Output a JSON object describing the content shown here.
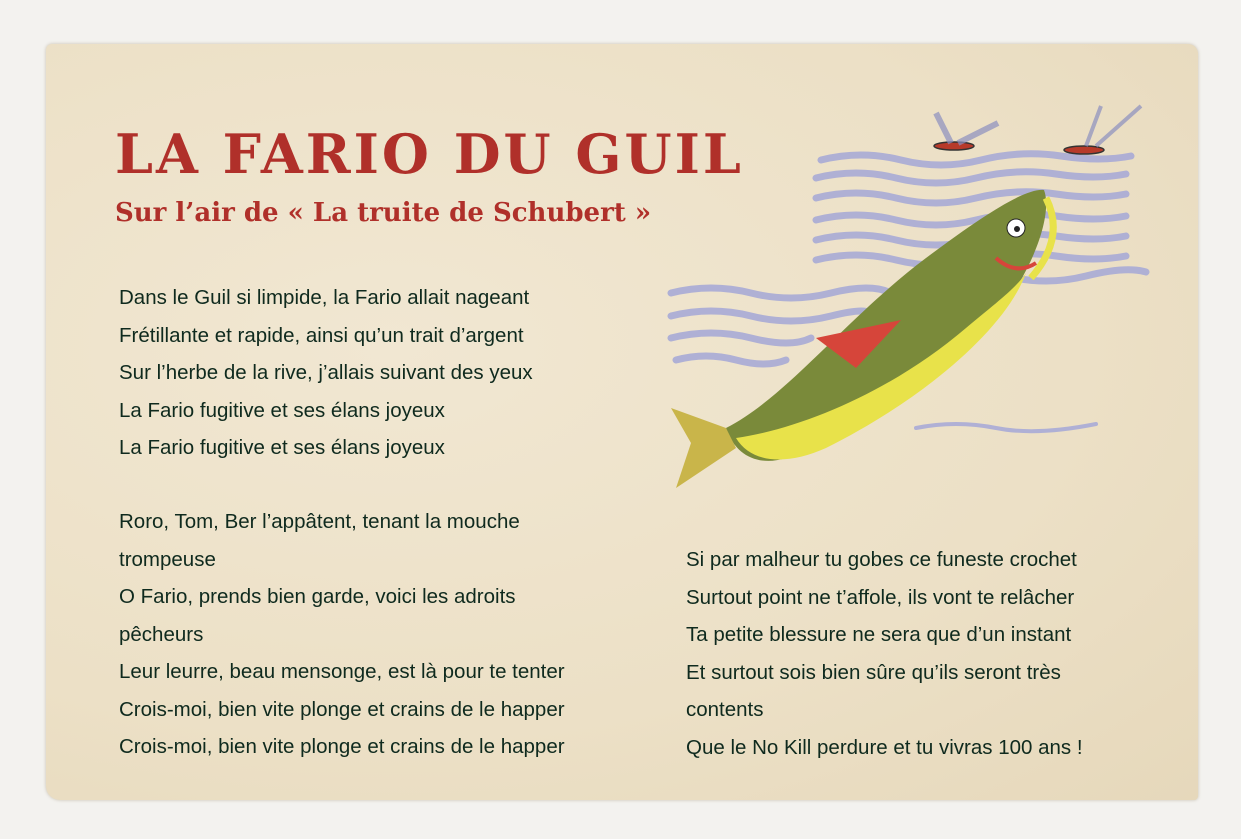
{
  "title": "LA FARIO DU GUIL",
  "subtitle": "Sur l’air de « La truite de Schubert »",
  "stanza1": [
    "Dans le Guil si limpide, la Fario allait nageant",
    "Frétillante et rapide, ainsi qu’un trait d’argent",
    "Sur l’herbe de la rive, j’allais suivant des yeux",
    "La Fario fugitive et ses élans joyeux",
    "La Fario fugitive et ses élans joyeux"
  ],
  "stanza2": [
    "Roro, Tom, Ber l’appâtent, tenant la mouche",
    "trompeuse",
    "O Fario, prends bien garde, voici les adroits",
    "pêcheurs",
    "Leur leurre, beau mensonge, est là pour te tenter",
    "Crois-moi, bien vite plonge et crains de le happer",
    "Crois-moi, bien vite plonge et crains de le happer"
  ],
  "stanza3": [
    "Si par malheur tu gobes ce funeste crochet",
    "Surtout point ne t’affole, ils vont te relâcher",
    "Ta petite blessure ne sera que d’un instant",
    "Et surtout sois bien sûre qu’ils seront très",
    "contents",
    "Que le No Kill perdure et tu vivras 100 ans !"
  ],
  "colors": {
    "title": "#b0302a",
    "text": "#0f2a1e",
    "paper": "#eee3cc",
    "waves": "#a9abd6"
  }
}
